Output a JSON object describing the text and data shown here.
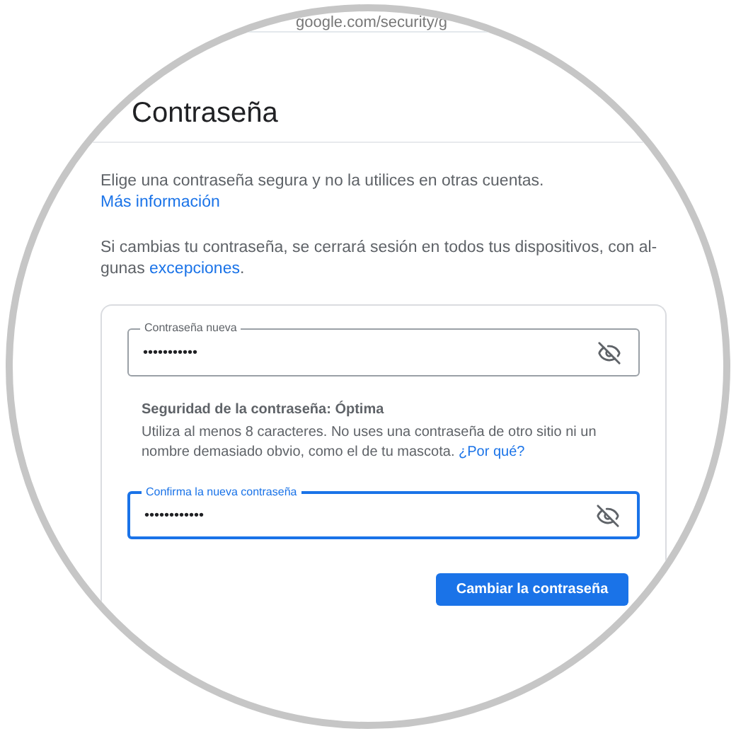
{
  "address_bar": {
    "url": "google.com/security/g"
  },
  "header": {
    "title": "Contraseña"
  },
  "intro": [
    {
      "segments": [
        {
          "kind": "text",
          "text": "Elige una contraseña segura y no la utilices en otras cuentas. "
        },
        {
          "kind": "link",
          "text": "Más información"
        }
      ]
    },
    {
      "segments": [
        {
          "kind": "text",
          "text": "Si cambias tu contraseña, se cerrará sesión en todos tus dispositivos, con al-\ngunas "
        },
        {
          "kind": "link",
          "text": "excepciones"
        },
        {
          "kind": "text",
          "text": "."
        }
      ]
    }
  ],
  "form": {
    "fields": [
      {
        "label": "Contraseña nueva",
        "value": "•••••••••••",
        "focused": false
      },
      {
        "label": "Confirma la nueva contraseña",
        "value": "••••••••••••",
        "focused": true
      }
    ],
    "strength": {
      "title": "Seguridad de la contraseña: Óptima",
      "segments": [
        {
          "kind": "text",
          "text": "Utiliza al menos 8 caracteres. No uses una contraseña de otro sitio ni un nombre demasiado obvio, como el de tu mascota. "
        },
        {
          "kind": "link",
          "text": "¿Por qué?"
        }
      ]
    },
    "submit": "Cambiar la contraseña"
  }
}
